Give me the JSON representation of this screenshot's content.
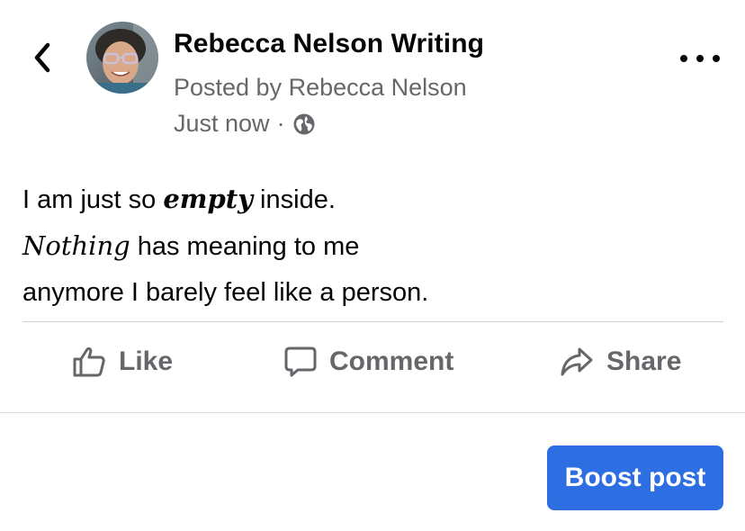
{
  "header": {
    "page_name": "Rebecca Nelson Writing",
    "posted_by": "Posted by Rebecca Nelson",
    "timestamp": "Just now",
    "separator": "·",
    "icons": {
      "back": "chevron-left-icon",
      "privacy": "globe-icon",
      "more": "more-options-icon"
    }
  },
  "post": {
    "line1_a": "I am just so ",
    "line1_em": "empty",
    "line1_b": " inside.",
    "line2_em": "Nothing",
    "line2_b": " has meaning to me",
    "line3": "anymore I barely feel like a person."
  },
  "actions": {
    "like": "Like",
    "comment": "Comment",
    "share": "Share"
  },
  "footer": {
    "boost_label": "Boost post"
  },
  "colors": {
    "accent": "#2d6fe3",
    "secondary_text": "#65676b",
    "primary_text": "#050505"
  }
}
